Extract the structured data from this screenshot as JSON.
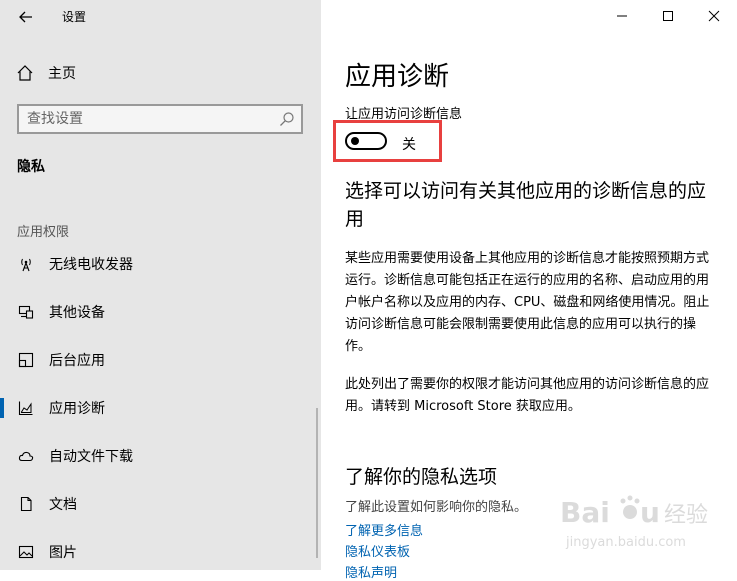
{
  "window": {
    "title": "设置",
    "back_icon": "arrow-left-icon",
    "controls": [
      "minimize-icon",
      "maximize-icon",
      "close-icon"
    ]
  },
  "sidebar": {
    "home_label": "主页",
    "search_placeholder": "查找设置",
    "section_label": "隐私",
    "group_label": "应用权限",
    "items": [
      {
        "label": "无线电收发器",
        "icon": "antenna-icon"
      },
      {
        "label": "其他设备",
        "icon": "devices-icon"
      },
      {
        "label": "后台应用",
        "icon": "background-apps-icon"
      },
      {
        "label": "应用诊断",
        "icon": "diagnostics-chart-icon",
        "active": true
      },
      {
        "label": "自动文件下载",
        "icon": "cloud-icon"
      },
      {
        "label": "文档",
        "icon": "document-icon"
      },
      {
        "label": "图片",
        "icon": "picture-icon"
      }
    ]
  },
  "main": {
    "title": "应用诊断",
    "toggle_caption": "让应用访问诊断信息",
    "toggle_state": "关",
    "toggle_on": false,
    "section_title": "选择可以访问有关其他应用的诊断信息的应用",
    "paragraph1": "某些应用需要使用设备上其他应用的诊断信息才能按照预期方式运行。诊断信息可能包括正在运行的应用的名称、启动应用的用户帐户名称以及应用的内存、CPU、磁盘和网络使用情况。阻止访问诊断信息可能会限制需要使用此信息的应用可以执行的操作。",
    "paragraph2": "此处列出了需要你的权限才能访问其他应用的访问诊断信息的应用。请转到 Microsoft Store 获取应用。",
    "privacy_title": "了解你的隐私选项",
    "privacy_desc": "了解此设置如何影响你的隐私。",
    "links": [
      "了解更多信息",
      "隐私仪表板",
      "隐私声明"
    ]
  },
  "watermark": {
    "brand": "Bai",
    "brand_end": "u",
    "cn": "经验",
    "url": "jingyan.baidu.com"
  },
  "colors": {
    "sidebar_bg": "#e6e6e6",
    "accent": "#0063b1",
    "highlight": "#e8403f"
  }
}
